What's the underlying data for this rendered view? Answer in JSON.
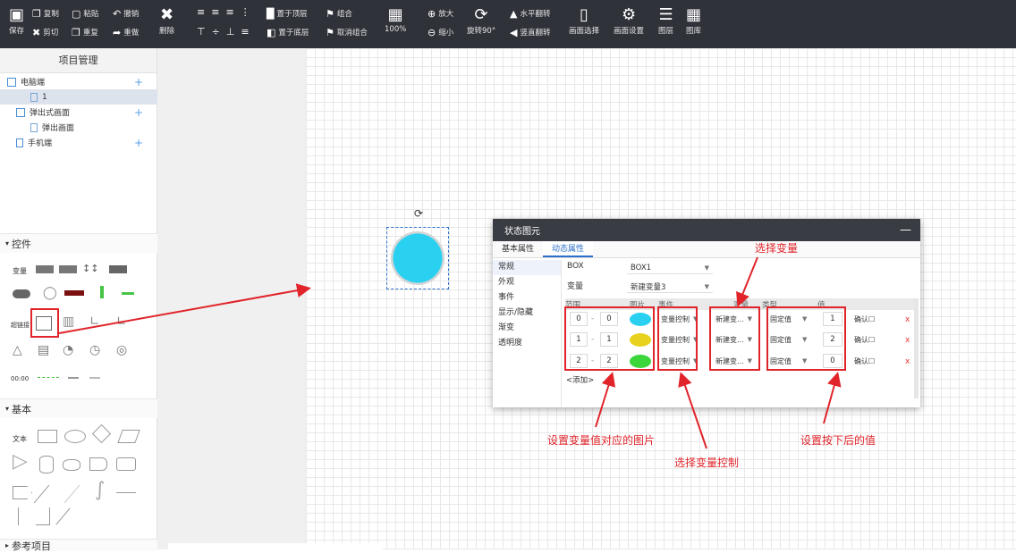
{
  "toolbar": {
    "save": "保存",
    "copy": "复制",
    "cut": "剪切",
    "paste": "粘贴",
    "redo_copy": "重复",
    "undo": "撤销",
    "redo": "重做",
    "delete": "删除",
    "bring_top": "置于顶层",
    "send_bottom": "置于底层",
    "group": "组合",
    "ungroup": "取消组合",
    "zoom_fit": "100%",
    "zoom_in": "放大",
    "zoom_out": "缩小",
    "rotate": "旋转90°",
    "flip_h": "水平翻转",
    "flip_v": "竖直翻转",
    "screen_select": "画面选择",
    "screen_settings": "画面设置",
    "layers": "图层",
    "gallery": "图库"
  },
  "sidebar": {
    "title": "项目管理",
    "tree": [
      {
        "label": "电脑端",
        "has_plus": true
      },
      {
        "label": "1",
        "has_plus": false
      },
      {
        "label": "弹出式画面",
        "has_plus": true
      },
      {
        "label": "弹出画面",
        "has_plus": false
      },
      {
        "label": "手机端",
        "has_plus": true
      }
    ],
    "controls_section": "控件",
    "basic_section": "基本",
    "ref_section": "参考项目",
    "labels": {
      "variable": "变量",
      "hyperlink": "超链接",
      "text": "文本",
      "time": "00:00"
    }
  },
  "dialog": {
    "title": "状态图元",
    "tabs": [
      "基本属性",
      "动态属性"
    ],
    "active_tab": "动态属性",
    "nav": [
      "常规",
      "外观",
      "事件",
      "显示/隐藏",
      "渐变",
      "透明度"
    ],
    "box_label": "BOX",
    "box_value": "BOX1",
    "var_label": "变量",
    "var_value": "新建变量3",
    "headers": [
      "范围",
      "图片",
      "事件",
      "变量",
      "类型",
      "值"
    ],
    "rows": [
      {
        "from": "0",
        "to": "0",
        "color": "#2ad0f0",
        "event": "变量控制",
        "var": "新建变...",
        "type": "固定值",
        "value": "1",
        "confirm": "确认"
      },
      {
        "from": "1",
        "to": "1",
        "color": "#e8d21e",
        "event": "变量控制",
        "var": "新建变...",
        "type": "固定值",
        "value": "2",
        "confirm": "确认"
      },
      {
        "from": "2",
        "to": "2",
        "color": "#3ad63a",
        "event": "变量控制",
        "var": "新建变...",
        "type": "固定值",
        "value": "0",
        "confirm": "确认"
      }
    ],
    "add_link": "<添加>",
    "delete_mark": "x"
  },
  "annotations": {
    "select_var": "选择变量",
    "set_image": "设置变量值对应的图片",
    "select_control": "选择变量控制",
    "set_value": "设置按下后的值"
  },
  "colors": {
    "toolbar_bg": "#30323a",
    "accent": "#2a6fc9",
    "annotation_red": "#e0242a",
    "button_cyan": "#2ad0f0"
  }
}
